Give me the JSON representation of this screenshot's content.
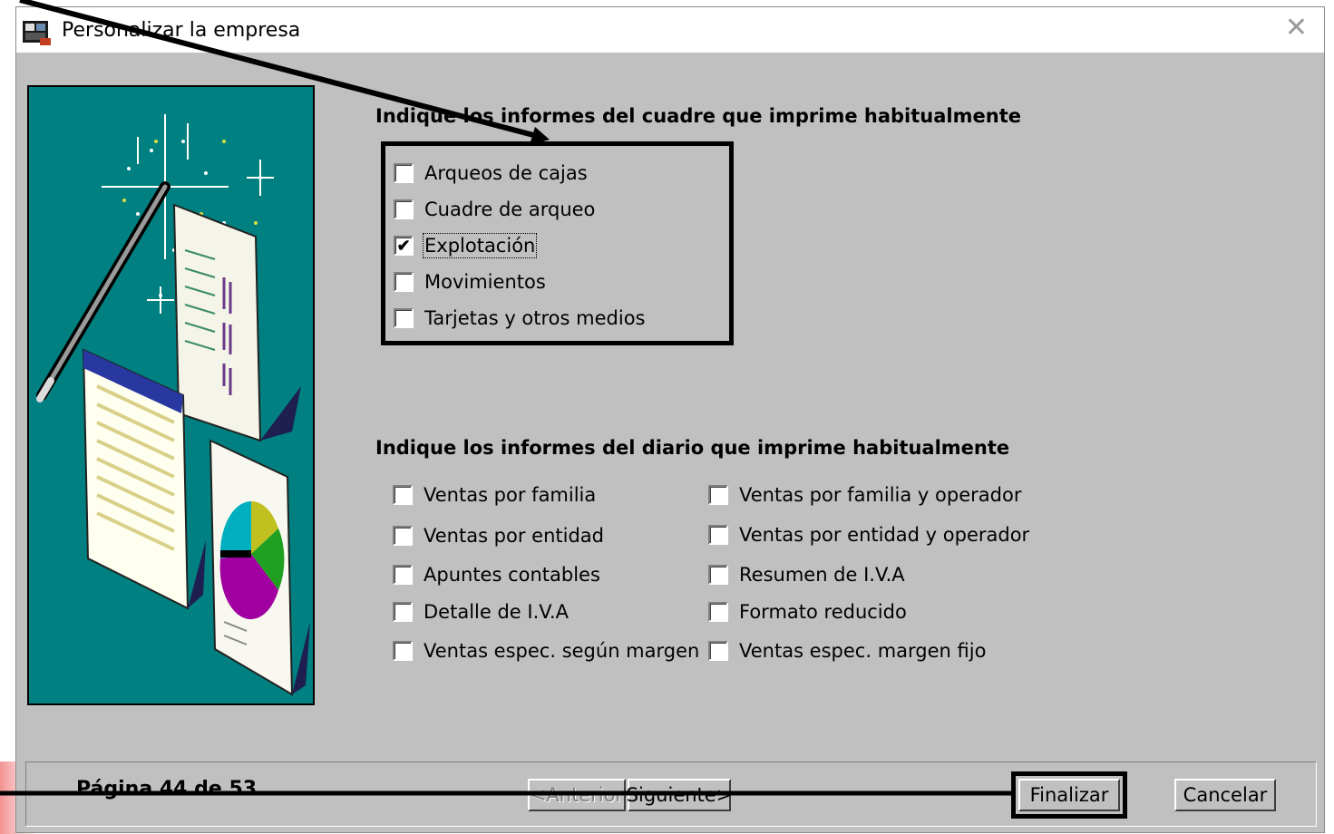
{
  "window": {
    "title": "Personalizar la empresa",
    "close_glyph": "✕"
  },
  "cuadre": {
    "title": "Indique los informes del cuadre que imprime habitualmente",
    "items": [
      {
        "label": "Arqueos de cajas",
        "checked": false
      },
      {
        "label": "Cuadre de arqueo",
        "checked": false
      },
      {
        "label": "Explotación",
        "checked": true
      },
      {
        "label": "Movimientos",
        "checked": false
      },
      {
        "label": "Tarjetas y otros medios",
        "checked": false
      }
    ]
  },
  "diario": {
    "title": "Indique los informes del diario que imprime habitualmente",
    "left_items": [
      {
        "label": "Ventas por familia",
        "checked": false
      },
      {
        "label": "Ventas por entidad",
        "checked": false
      },
      {
        "label": "Apuntes contables",
        "checked": false
      },
      {
        "label": "Detalle de I.V.A",
        "checked": false
      },
      {
        "label": "Ventas espec. según margen",
        "checked": false
      }
    ],
    "right_items": [
      {
        "label": "Ventas por familia y operador",
        "checked": false
      },
      {
        "label": "Ventas por entidad y operador",
        "checked": false
      },
      {
        "label": "Resumen de I.V.A",
        "checked": false
      },
      {
        "label": "Formato reducido",
        "checked": false
      },
      {
        "label": "Ventas espec. margen fijo",
        "checked": false
      }
    ]
  },
  "footer": {
    "page_label": "Página 44 de 53",
    "anterior_label": "<Anterior",
    "siguiente_label": "Siguiente>",
    "finalizar_label": "Finalizar",
    "cancelar_label": "Cancelar"
  },
  "colors": {
    "dialog_bg": "#c0c0c0",
    "illustration_bg": "#008080",
    "highlight": "#000000"
  },
  "icons": {
    "app": "nexo-app-icon",
    "close": "close-icon",
    "illustration": "wizard-wand-documents-illustration"
  }
}
